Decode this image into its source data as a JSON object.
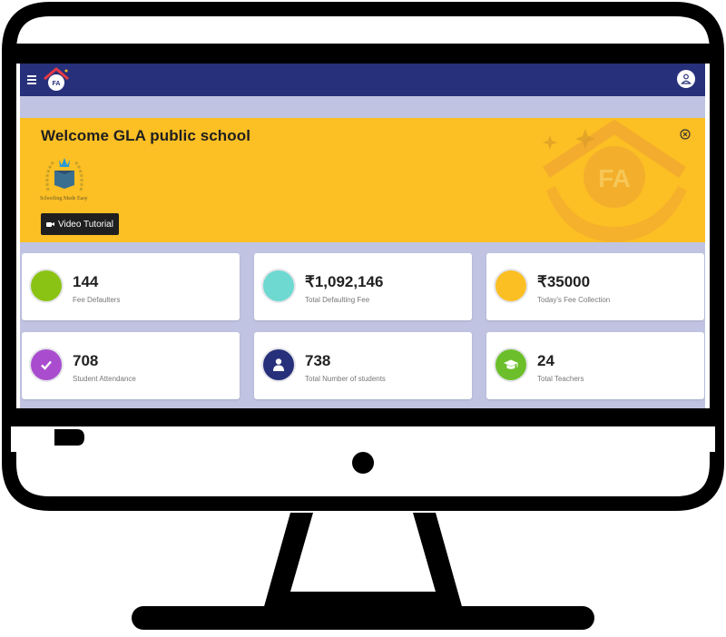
{
  "header": {
    "menu_icon": "menu-icon",
    "logo_icon": "fa-logo-icon",
    "profile_icon": "user-icon"
  },
  "banner": {
    "welcome": "Welcome GLA public school",
    "tagline": "Schooling Made Easy",
    "video_button": "Video Tutorial",
    "video_icon": "video-camera-icon",
    "close_icon": "close-circle-icon",
    "background_color": "#fcbf24"
  },
  "stats": [
    {
      "value": "144",
      "label": "Fee Defaulters",
      "color": "#8bc314",
      "icon": ""
    },
    {
      "value": "₹1,092,146",
      "label": "Total Defaulting Fee",
      "color": "#6dd9d0",
      "icon": ""
    },
    {
      "value": "₹35000",
      "label": "Today's Fee Collection",
      "color": "#fbbf24",
      "icon": ""
    },
    {
      "value": "708",
      "label": "Student Attendance",
      "color": "#a94dce",
      "icon": "check-icon"
    },
    {
      "value": "738",
      "label": "Total Number of students",
      "color": "#27307a",
      "icon": "person-icon"
    },
    {
      "value": "24",
      "label": "Total Teachers",
      "color": "#6cbf2b",
      "icon": "graduation-cap-icon"
    }
  ],
  "colors": {
    "topbar": "#27307a",
    "screen_background": "#c0c4e2"
  }
}
